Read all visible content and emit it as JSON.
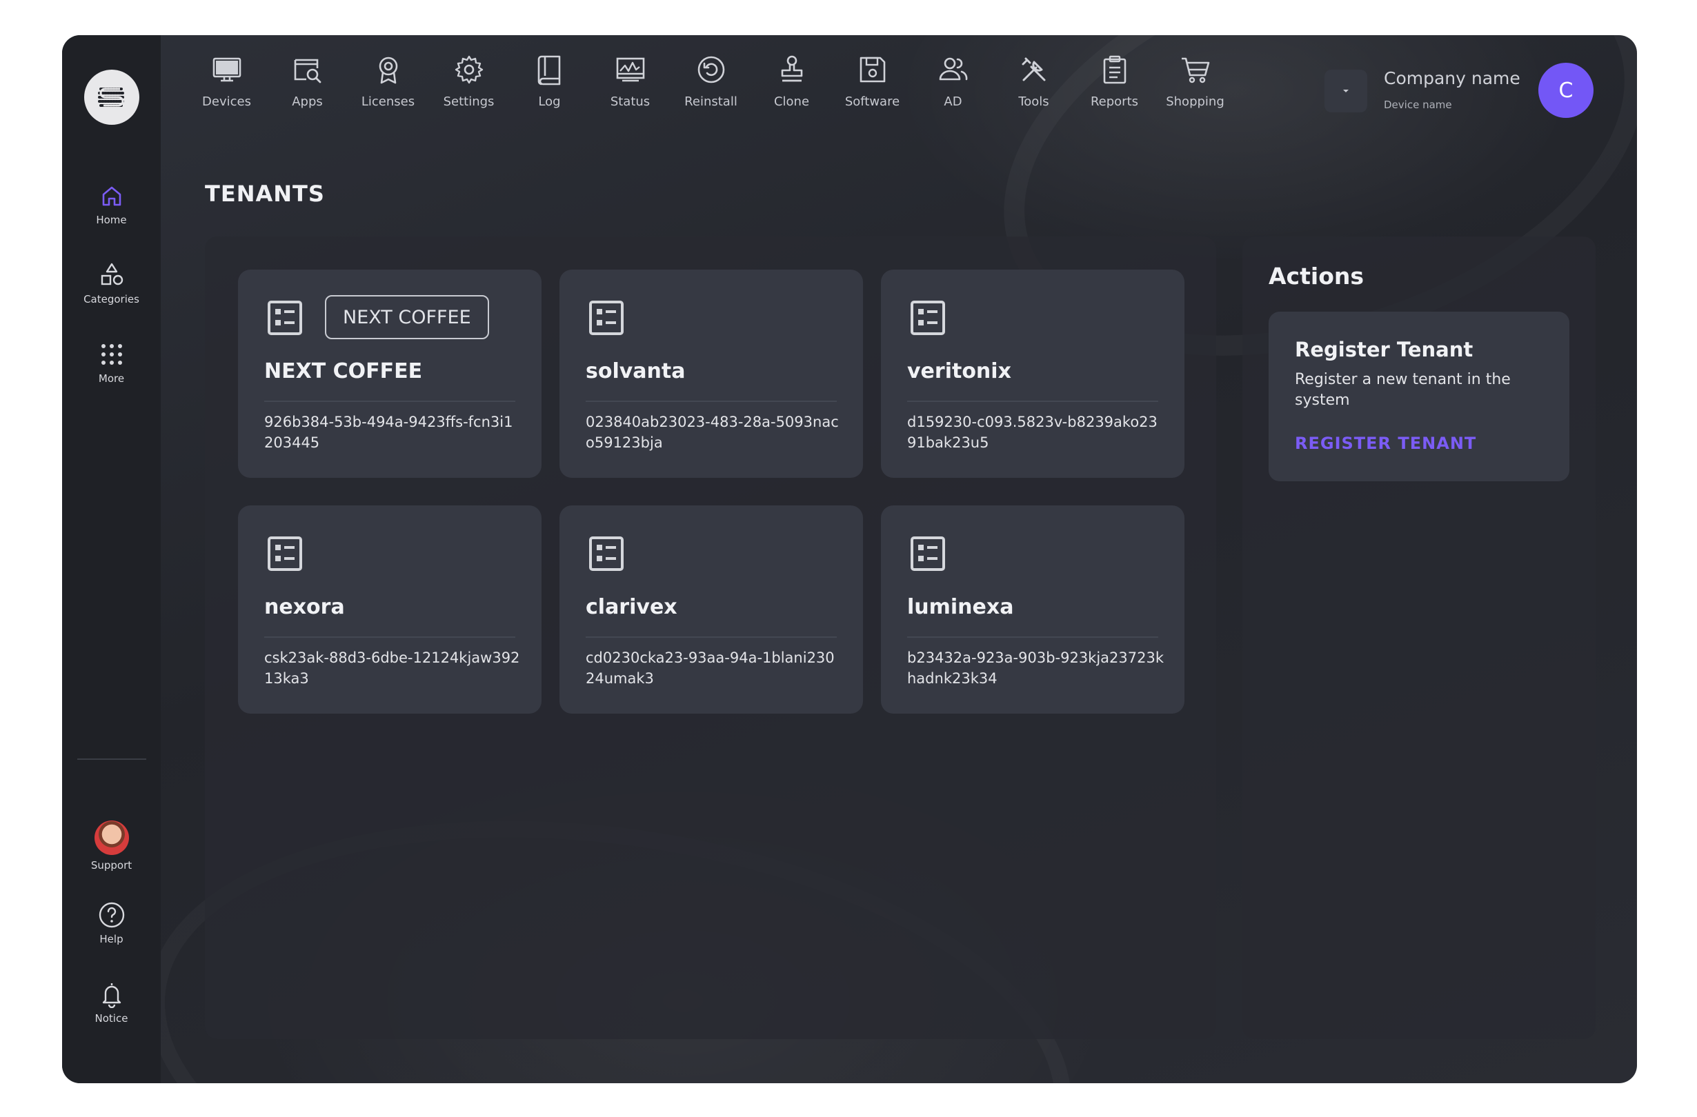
{
  "sidebar": {
    "top": [
      {
        "label": "Home",
        "icon": "home-icon",
        "active": true
      },
      {
        "label": "Categories",
        "icon": "categories-icon"
      },
      {
        "label": "More",
        "icon": "more-dots-icon"
      }
    ],
    "bottom": [
      {
        "label": "Support",
        "icon": "support-avatar"
      },
      {
        "label": "Help",
        "icon": "help-icon"
      },
      {
        "label": "Notice",
        "icon": "bell-icon"
      }
    ]
  },
  "topnav": [
    {
      "label": "Devices",
      "icon": "monitor-icon"
    },
    {
      "label": "Apps",
      "icon": "apps-search-icon"
    },
    {
      "label": "Licenses",
      "icon": "award-icon"
    },
    {
      "label": "Settings",
      "icon": "gear-icon"
    },
    {
      "label": "Log",
      "icon": "book-icon"
    },
    {
      "label": "Status",
      "icon": "status-chart-icon"
    },
    {
      "label": "Reinstall",
      "icon": "reinstall-icon"
    },
    {
      "label": "Clone",
      "icon": "stamp-icon"
    },
    {
      "label": "Software",
      "icon": "save-icon"
    },
    {
      "label": "AD",
      "icon": "users-icon"
    },
    {
      "label": "Tools",
      "icon": "tools-icon"
    },
    {
      "label": "Reports",
      "icon": "clipboard-icon"
    },
    {
      "label": "Shopping",
      "icon": "cart-icon"
    }
  ],
  "account": {
    "company": "Company name",
    "device": "Device name",
    "initial": "C"
  },
  "page": {
    "title": "TENANTS"
  },
  "tenants": [
    {
      "tag": "NEXT COFFEE",
      "name": "NEXT COFFEE",
      "id": "926b384-53b-494a-9423ffs-fcn3i1203445"
    },
    {
      "name": "solvanta",
      "id": "023840ab23023-483-28a-5093nac o59123bja"
    },
    {
      "name": "veritonix",
      "id": "d159230-c093.5823v-b8239ako2391bak23u5"
    },
    {
      "name": "nexora",
      "id": "csk23ak-88d3-6dbe-12124kjaw392 13ka3"
    },
    {
      "name": "clarivex",
      "id": "cd0230cka23-93aa-94a-1blani230 24umak3"
    },
    {
      "name": "luminexa",
      "id": "b23432a-923a-903b-923kja23723k hadnk23k34"
    }
  ],
  "actions": {
    "title": "Actions",
    "card": {
      "title": "Register Tenant",
      "description": "Register a new tenant in the system",
      "link": "REGISTER TENANT"
    }
  },
  "colors": {
    "accent": "#7357f6",
    "link": "#7b5cf5",
    "background": "#26282e",
    "card": "#363943"
  }
}
